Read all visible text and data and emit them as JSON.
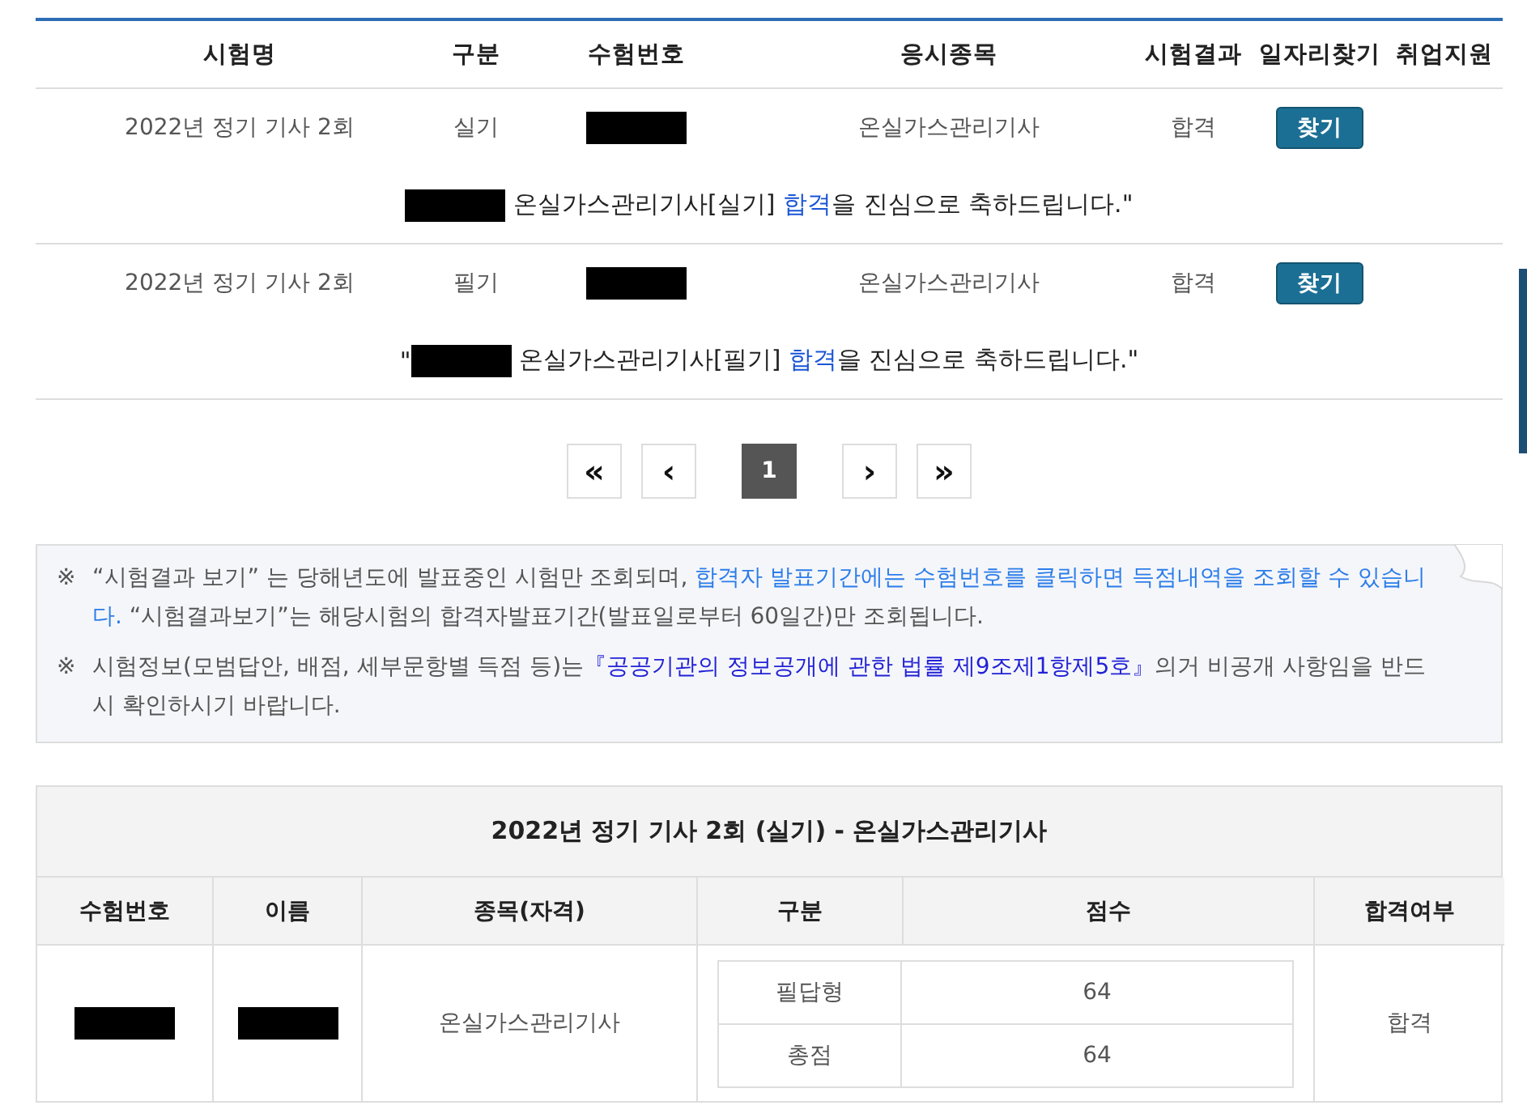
{
  "results": {
    "columns": [
      "시험명",
      "구분",
      "수험번호",
      "응시종목",
      "시험결과",
      "일자리찾기",
      "취업지원"
    ],
    "rows": [
      {
        "exam": "2022년 정기 기사 2회",
        "type": "실기",
        "subject": "온실가스관리기사",
        "result": "합격",
        "button": "찾기",
        "message": {
          "text": " 온실가스관리기사[실기] ",
          "highlight": "합격",
          "tail": "을 진심으로 축하드립니다.\""
        }
      },
      {
        "exam": "2022년 정기 기사 2회",
        "type": "필기",
        "subject": "온실가스관리기사",
        "result": "합격",
        "button": "찾기",
        "message": {
          "lead": "\"",
          "text": " 온실가스관리기사[필기] ",
          "highlight": "합격",
          "tail": "을 진심으로 축하드립니다.\""
        }
      }
    ]
  },
  "pagination": [
    {
      "label": "«",
      "selected": false
    },
    {
      "label": "‹",
      "selected": false
    },
    {
      "label": "1",
      "selected": true
    },
    {
      "label": "›",
      "selected": false
    },
    {
      "label": "»",
      "selected": false
    }
  ],
  "notes": [
    {
      "mark": "※",
      "parts": [
        {
          "kind": "plain",
          "text": "“시험결과 보기” 는 당해년도에 발표중인 시험만 조회되며, "
        },
        {
          "kind": "link",
          "text": "합격자 발표기간에는 수험번호를 클릭하면 득점내역을 조회할 수 있습니다."
        },
        {
          "kind": "plain",
          "text": " “시험결과보기”는 해당시험의 합격자발표기간(발표일로부터 60일간)만 조회됩니다."
        }
      ]
    },
    {
      "mark": "※",
      "parts": [
        {
          "kind": "plain",
          "text": "시험정보(모범답안, 배점, 세부문항별 득점 등)는"
        },
        {
          "kind": "law",
          "text": "『공공기관의 정보공개에 관한 법률 제9조제1항제5호』"
        },
        {
          "kind": "plain",
          "text": "의거 비공개 사항임을 반드시 확인하시기 바랍니다."
        }
      ]
    }
  ],
  "score": {
    "title": "2022년 정기 기사 2회 (실기) - 온실가스관리기사",
    "columns": [
      "수험번호",
      "이름",
      "종목(자격)",
      "구분",
      "점수",
      "합격여부"
    ],
    "subject": "온실가스관리기사",
    "items": [
      {
        "label": "필답형",
        "score": "64"
      },
      {
        "label": "총점",
        "score": "64"
      }
    ],
    "result": "합격"
  }
}
